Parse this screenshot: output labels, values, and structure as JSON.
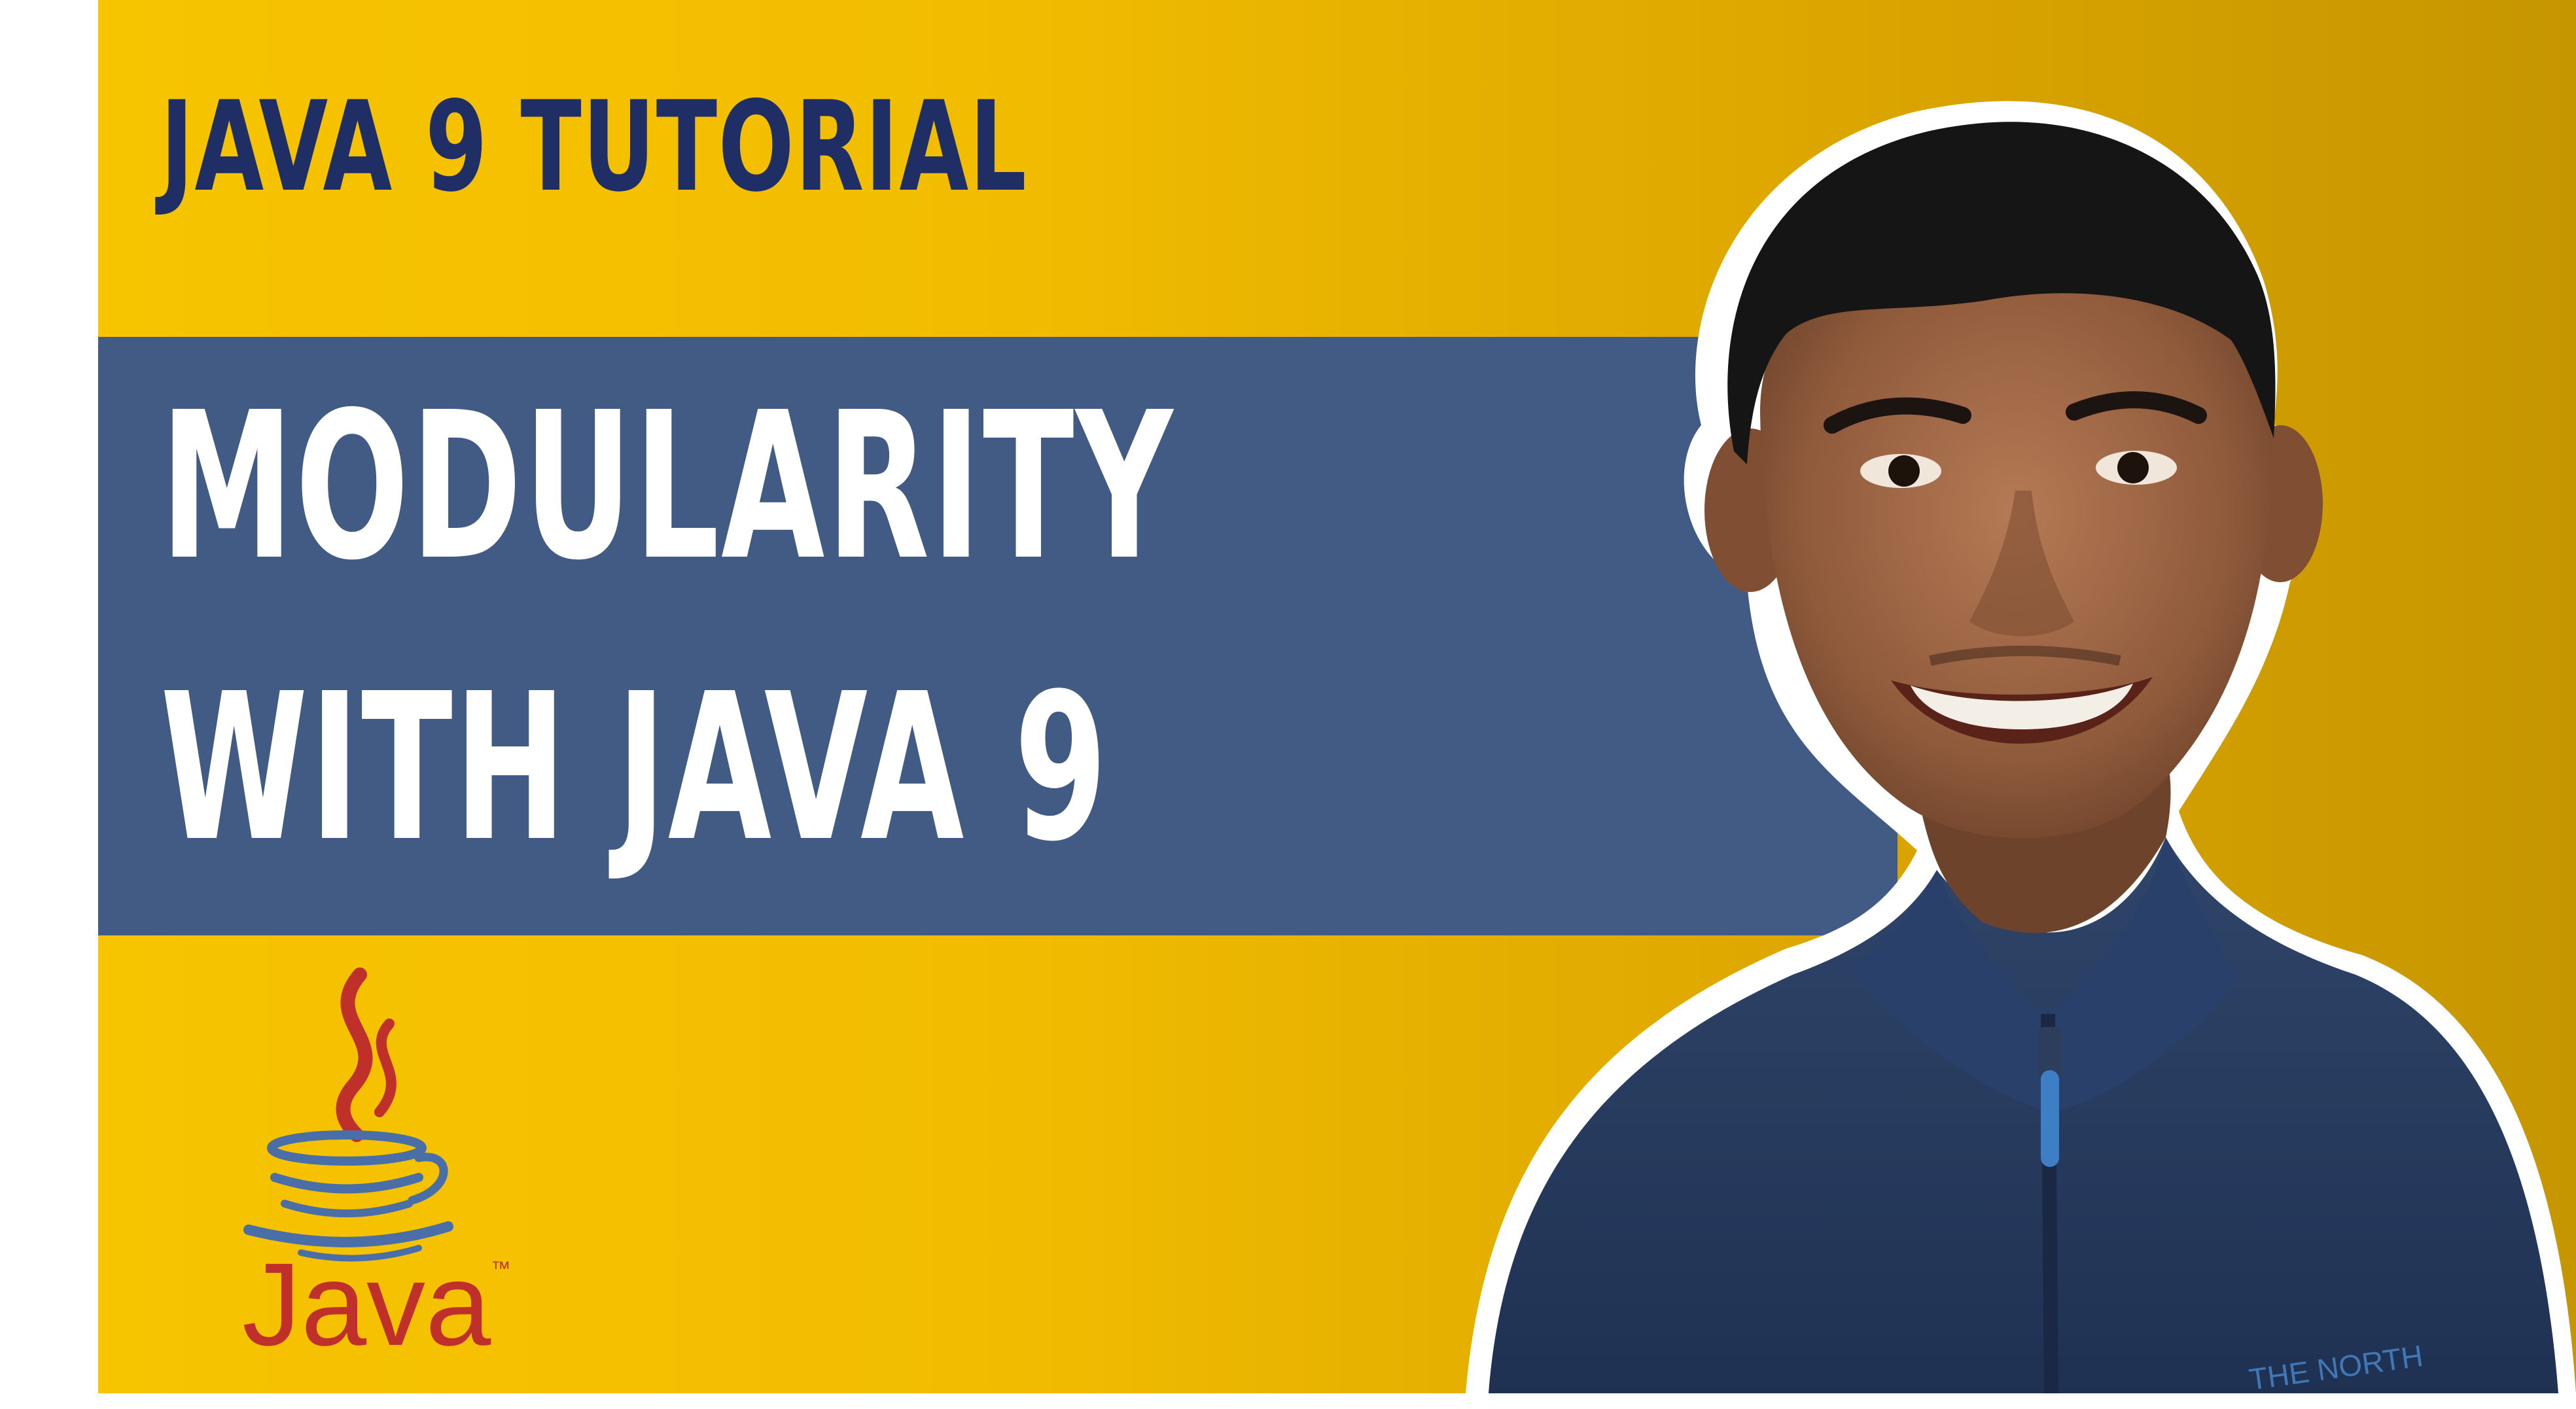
{
  "thumbnail": {
    "series_title": "JAVA 9 TUTORIAL",
    "headline_line_1": "MODULARITY",
    "headline_line_2": "WITH JAVA 9",
    "logo": {
      "icon": "java-coffee-cup-icon",
      "wordmark": "Java",
      "trademark": "™"
    },
    "photo": {
      "jacket_brand_text": "THE NORTH"
    },
    "colors": {
      "background": "#f2bd00",
      "title_text": "#1f2f66",
      "banner": "#415b85",
      "banner_text": "#ffffff",
      "java_red": "#c0302a",
      "java_blue": "#4a6fa8"
    }
  }
}
